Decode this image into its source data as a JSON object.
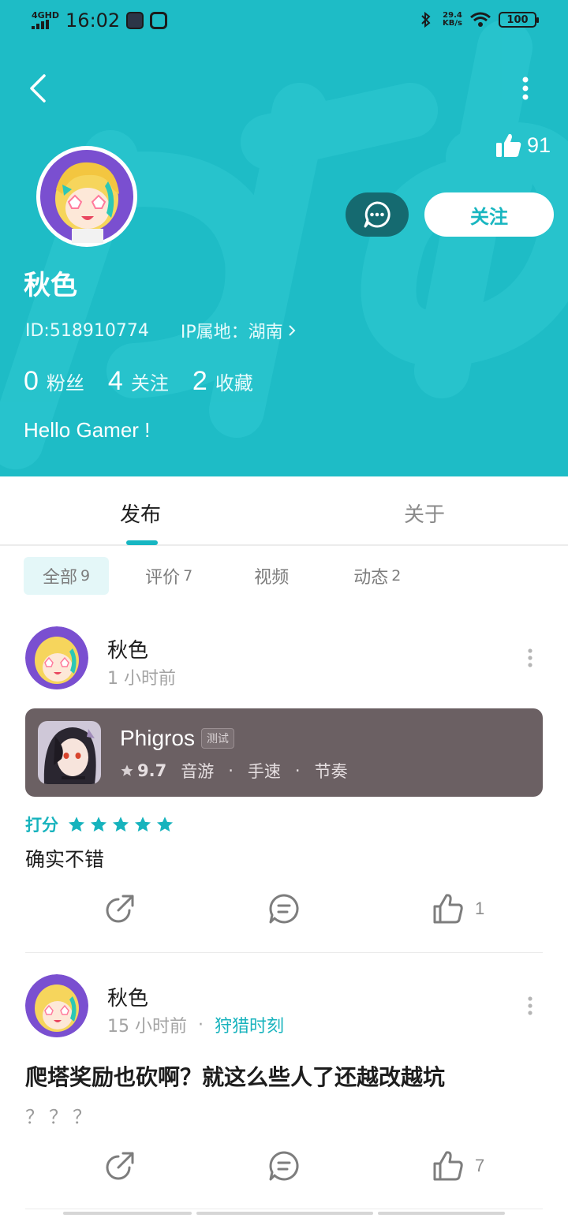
{
  "status_bar": {
    "network": "4GHD",
    "time": "16:02",
    "speed_value": "29.4",
    "speed_unit": "KB/s",
    "battery": "100"
  },
  "profile": {
    "likes": "91",
    "follow_label": "关注",
    "nickname": "秋色",
    "id_text": "ID:518910774",
    "ip_text": "IP属地：湖南",
    "stats": [
      {
        "num": "0",
        "label": "粉丝"
      },
      {
        "num": "4",
        "label": "关注"
      },
      {
        "num": "2",
        "label": "收藏"
      }
    ],
    "bio": "Hello Gamer !"
  },
  "tabs": {
    "posts": "发布",
    "about": "关于"
  },
  "filters": [
    {
      "label": "全部",
      "count": "9"
    },
    {
      "label": "评价",
      "count": "7"
    },
    {
      "label": "视频",
      "count": ""
    },
    {
      "label": "动态",
      "count": "2"
    }
  ],
  "posts": [
    {
      "author": "秋色",
      "time": "1 小时前",
      "game": {
        "title": "Phigros",
        "badge": "测试",
        "score": "9.7",
        "tags": [
          "音游",
          "手速",
          "节奏"
        ]
      },
      "rating_label": "打分",
      "rating_stars": 5,
      "text": "确实不错",
      "likes": "1"
    },
    {
      "author": "秋色",
      "time": "15 小时前",
      "dot": "·",
      "topic": "狩猎时刻",
      "title": "爬塔奖励也砍啊？就这么些人了还越改越坑",
      "sub": "？？？",
      "likes": "7"
    }
  ],
  "colors": {
    "header": "#1ebcc6",
    "accent": "#17b6c2",
    "message_button": "#156a70",
    "game_card": "#6b6063"
  }
}
